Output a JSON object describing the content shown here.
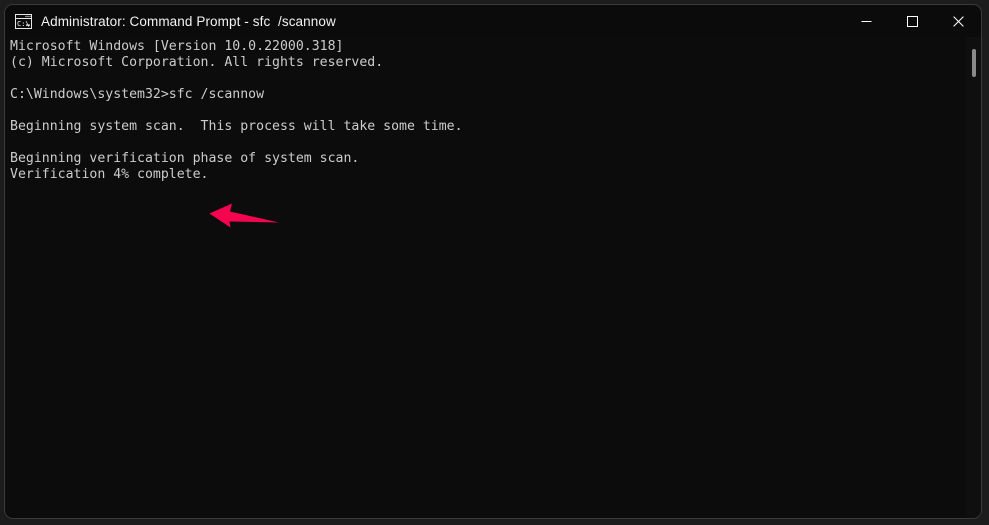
{
  "window": {
    "title": "Administrator: Command Prompt - sfc  /scannow",
    "icon_name": "command-prompt-icon",
    "icon_label": "C:\\_",
    "controls": {
      "minimize_label": "Minimize",
      "maximize_label": "Maximize",
      "close_label": "Close"
    },
    "background_color": "#0c0c0c",
    "titlebar_color": "#0b0b0b",
    "border_color": "#3a3a3a"
  },
  "terminal": {
    "text_color": "#cccccc",
    "lines": [
      "Microsoft Windows [Version 10.0.22000.318]",
      "(c) Microsoft Corporation. All rights reserved.",
      "",
      "C:\\Windows\\system32>sfc /scannow",
      "",
      "Beginning system scan.  This process will take some time.",
      "",
      "Beginning verification phase of system scan.",
      "Verification 4% complete."
    ],
    "content": "Microsoft Windows [Version 10.0.22000.318]\n(c) Microsoft Corporation. All rights reserved.\n\nC:\\Windows\\system32>sfc /scannow\n\nBeginning system scan.  This process will take some time.\n\nBeginning verification phase of system scan.\nVerification 4% complete."
  },
  "scrollbar": {
    "thumb_color": "#8a8a8a",
    "track_color": "#0f0f0f"
  },
  "annotation": {
    "name": "left-pointing-arrow",
    "color": "#f5054f",
    "points_at": "Verification 4% complete."
  }
}
